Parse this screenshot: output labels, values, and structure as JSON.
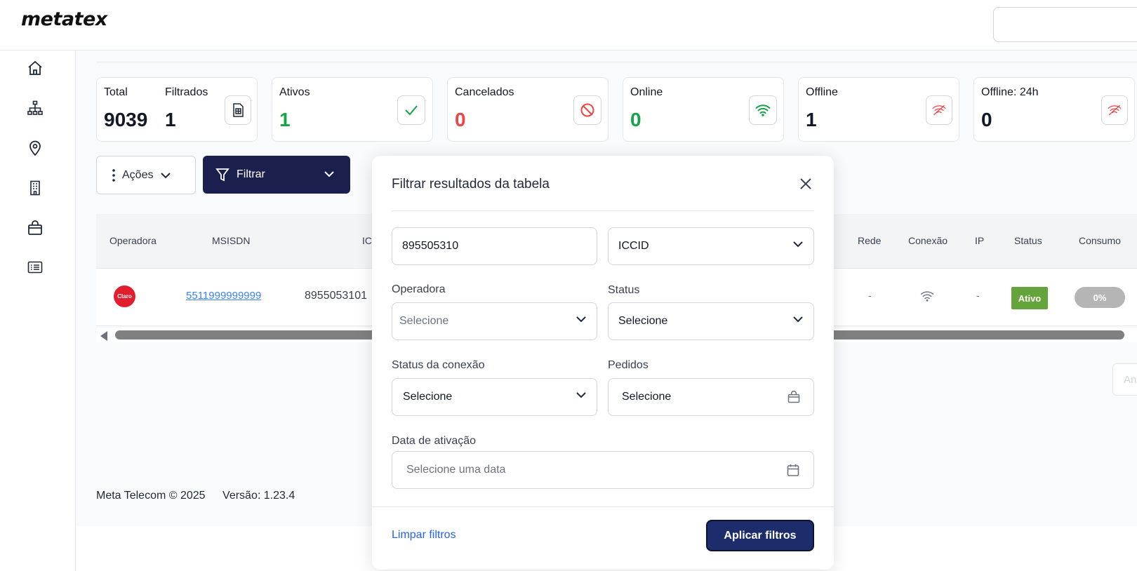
{
  "app": {
    "logo": "metatex"
  },
  "sidebar": {
    "items": [
      {
        "icon": "home-icon"
      },
      {
        "icon": "org-chart-icon"
      },
      {
        "icon": "location-pin-icon"
      },
      {
        "icon": "building-icon"
      },
      {
        "icon": "shopping-bag-icon"
      },
      {
        "icon": "list-icon"
      }
    ]
  },
  "stats": {
    "total_label": "Total",
    "total_value": "9039",
    "filtrados_label": "Filtrados",
    "filtrados_value": "1",
    "ativos_label": "Ativos",
    "ativos_value": "1",
    "cancelados_label": "Cancelados",
    "cancelados_value": "0",
    "online_label": "Online",
    "online_value": "0",
    "offline_label": "Offline",
    "offline_value": "1",
    "offline24_label": "Offline: 24h",
    "offline24_value": "0"
  },
  "toolbar": {
    "acoes_label": "Ações",
    "filtrar_label": "Filtrar"
  },
  "table": {
    "headers": {
      "operadora": "Operadora",
      "msisdn": "MSISDN",
      "iccid": "IC",
      "rede": "Rede",
      "conexao": "Conexão",
      "ip": "IP",
      "status": "Status",
      "consumo": "Consumo"
    },
    "row": {
      "operadora_logo_text": "Claro",
      "msisdn": "5511999999999",
      "iccid": "8955053101",
      "rede": "-",
      "ip": "-",
      "status": "Ativo",
      "consumo": "0%"
    }
  },
  "pager": {
    "next_label": "An"
  },
  "footer": {
    "copyright": "Meta Telecom © 2025",
    "version": "Versão: 1.23.4"
  },
  "modal": {
    "title": "Filtrar resultados da tabela",
    "search_value": "895505310",
    "search_type": "ICCID",
    "operadora_label": "Operadora",
    "operadora_placeholder": "Selecione",
    "status_label": "Status",
    "status_value": "Selecione",
    "status_conexao_label": "Status da conexão",
    "status_conexao_value": "Selecione",
    "pedidos_label": "Pedidos",
    "pedidos_value": "Selecione",
    "data_label": "Data de ativação",
    "data_placeholder": "Selecione uma data",
    "clear_label": "Limpar filtros",
    "apply_label": "Aplicar filtros"
  },
  "colors": {
    "primary": "#1a1f4e",
    "green": "#16a34a",
    "red": "#ef4444",
    "status_active": "#65a43a"
  }
}
